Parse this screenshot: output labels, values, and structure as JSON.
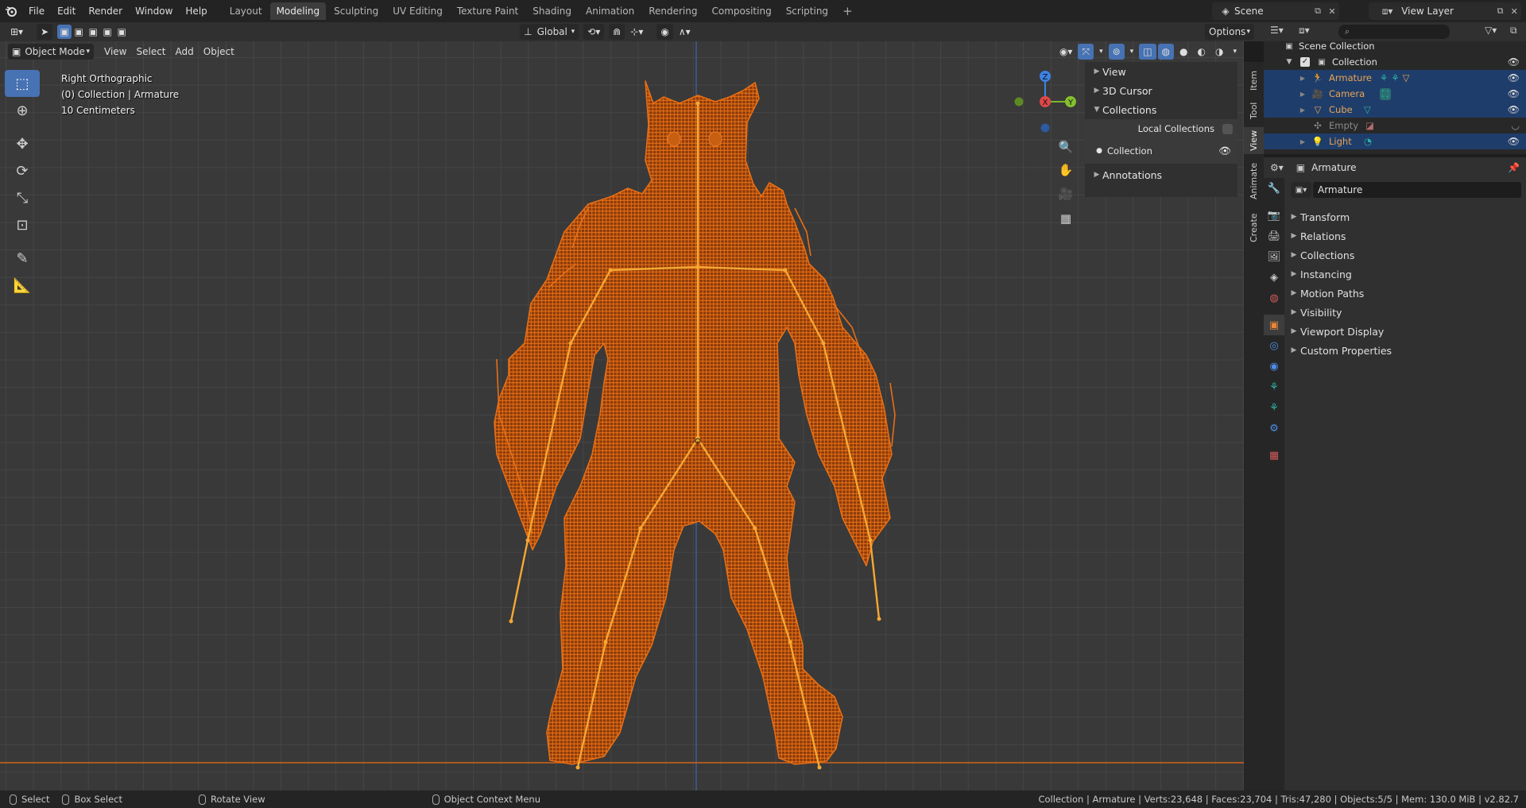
{
  "menus": [
    "File",
    "Edit",
    "Render",
    "Window",
    "Help"
  ],
  "workspace_tabs": [
    "Layout",
    "Modeling",
    "Sculpting",
    "UV Editing",
    "Texture Paint",
    "Shading",
    "Animation",
    "Rendering",
    "Compositing",
    "Scripting"
  ],
  "active_workspace": "Modeling",
  "scene": "Scene",
  "view_layer": "View Layer",
  "header": {
    "mode": "Object Mode",
    "menus": [
      "View",
      "Select",
      "Add",
      "Object"
    ],
    "orientation": "Global",
    "options": "Options"
  },
  "viewport_info": {
    "view_name": "Right Orthographic",
    "context": "(0) Collection | Armature",
    "scale": "10 Centimeters"
  },
  "gizmo": {
    "z": "Z",
    "x": "X",
    "y": "Y"
  },
  "npanel": {
    "sections": [
      "View",
      "3D Cursor",
      "Collections"
    ],
    "local_collections": "Local Collections",
    "collection_item": "Collection",
    "annotations": "Annotations"
  },
  "side_tabs": [
    "Item",
    "Tool",
    "View",
    "Animate",
    "Create"
  ],
  "active_side_tab": "View",
  "outliner": {
    "root": "Scene Collection",
    "collection": "Collection",
    "items": [
      {
        "name": "Armature",
        "selected": true,
        "color": "#e8a454"
      },
      {
        "name": "Camera",
        "selected": true,
        "color": "#e8a454"
      },
      {
        "name": "Cube",
        "selected": true,
        "color": "#e8a454"
      },
      {
        "name": "Empty",
        "selected": false,
        "color": "#8a8a8a"
      },
      {
        "name": "Light",
        "selected": true,
        "color": "#e8a454"
      }
    ]
  },
  "properties": {
    "header_object": "Armature",
    "name_field": "Armature",
    "sections": [
      "Transform",
      "Relations",
      "Collections",
      "Instancing",
      "Motion Paths",
      "Visibility",
      "Viewport Display",
      "Custom Properties"
    ]
  },
  "statusbar": {
    "select": "Select",
    "box_select": "Box Select",
    "rotate_view": "Rotate View",
    "context_menu": "Object Context Menu",
    "stats": "Collection | Armature | Verts:23,648 | Faces:23,704 | Tris:47,280 | Objects:5/5 | Mem: 130.0 MiB | v2.82.7"
  },
  "colors": {
    "accent": "#4772b3",
    "wire": "#e66f16",
    "bone": "#f4b24a",
    "selected_row": "#1f3d6a"
  },
  "icons": [
    "blender-logo-icon",
    "cursor-icon",
    "move-icon",
    "rotate-icon",
    "scale-icon",
    "transform-icon",
    "annotate-icon",
    "measure-icon",
    "zoom-icon",
    "hand-icon",
    "camera-icon",
    "grid-icon",
    "eye-icon",
    "funnel-icon",
    "pin-icon"
  ]
}
